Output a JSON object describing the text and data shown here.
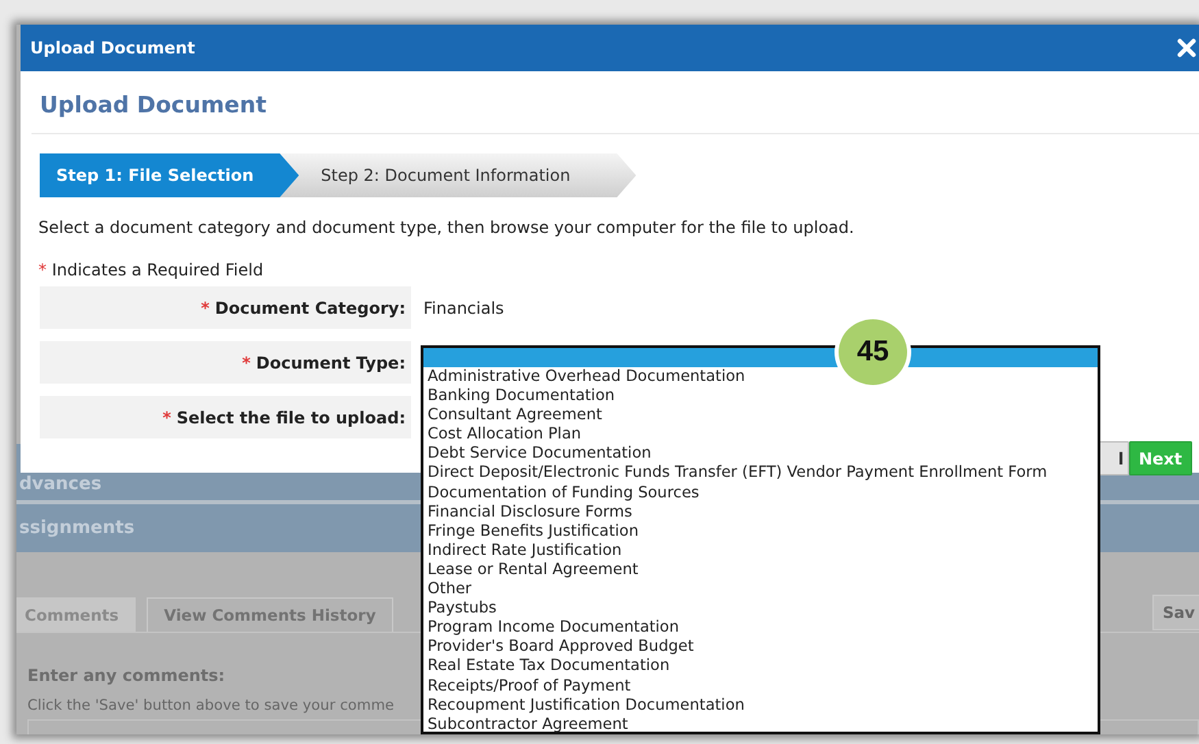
{
  "window": {
    "title": "Upload Document"
  },
  "heading": "Upload Document",
  "steps": [
    {
      "label": "Step 1: File Selection",
      "selected": true
    },
    {
      "label": "Step 2: Document Information",
      "selected": false
    }
  ],
  "instructions": "Select a document category and document type, then browse your computer for the file to upload.",
  "required_mark": "*",
  "required_note": "Indicates a Required Field",
  "fields": [
    {
      "label": "Document Category:",
      "required": true,
      "value": "Financials"
    },
    {
      "label": "Document Type:",
      "required": true
    },
    {
      "label": "Select the file to upload:",
      "required": true
    }
  ],
  "dropdown": {
    "blank_option_highlighted": true,
    "options": [
      "Administrative Overhead Documentation",
      "Banking Documentation",
      "Consultant Agreement",
      "Cost Allocation Plan",
      "Debt Service Documentation",
      "Direct Deposit/Electronic Funds Transfer (EFT) Vendor Payment Enrollment Form",
      "Documentation of Funding Sources",
      "Financial Disclosure Forms",
      "Fringe Benefits Justification",
      "Indirect Rate Justification",
      "Lease or Rental Agreement",
      "Other",
      "Paystubs",
      "Program Income Documentation",
      "Provider's Board Approved Budget",
      "Real Estate Tax Documentation",
      "Receipts/Proof of Payment",
      "Recoupment Justification Documentation",
      "Subcontractor Agreement"
    ]
  },
  "badge": "45",
  "buttons": [
    {
      "label": "l",
      "kind": "secondary"
    },
    {
      "label": "Next",
      "kind": "primary"
    }
  ],
  "background": {
    "sections": [
      "dvances",
      "ssignments"
    ],
    "tabs": [
      {
        "label": "Comments",
        "selected": true
      },
      {
        "label": "View Comments History",
        "selected": false
      }
    ],
    "save_button": "Sav",
    "comments_label": "Enter any comments:",
    "comments_hint": "Click the 'Save' button above to save your comme"
  }
}
